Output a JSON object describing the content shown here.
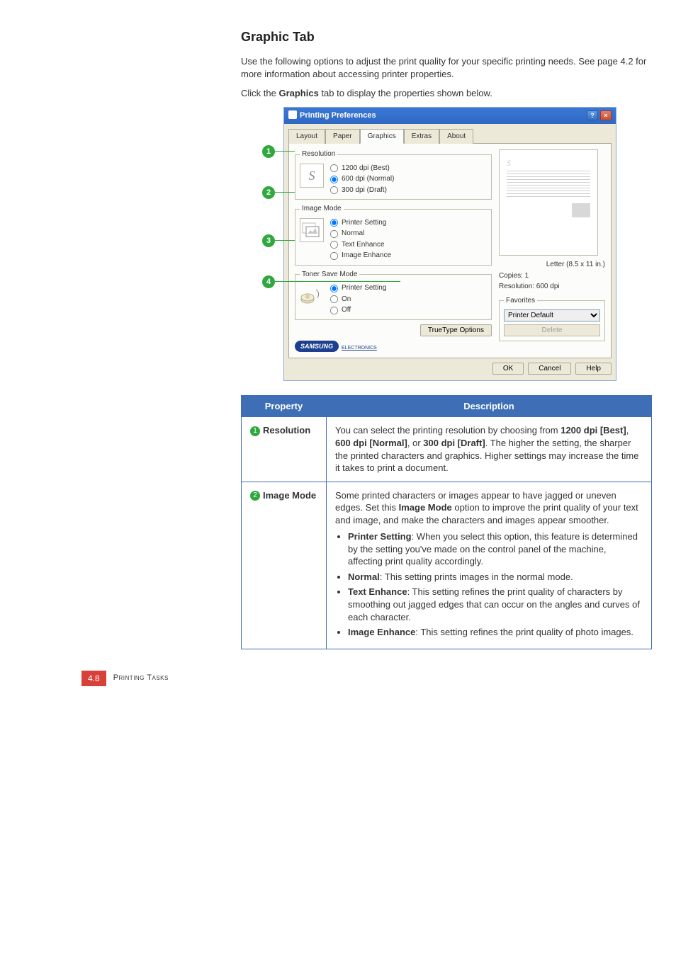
{
  "section": {
    "title": "Graphic Tab",
    "intro": "Use the following options to adjust the print quality for your specific printing needs. See page 4.2 for more information about accessing printer properties.",
    "click_line_prefix": "Click the ",
    "click_line_bold": "Graphics",
    "click_line_suffix": " tab to display the properties shown below."
  },
  "dialog": {
    "title": "Printing Preferences",
    "help_btn": "?",
    "close_btn": "×",
    "tabs": [
      "Layout",
      "Paper",
      "Graphics",
      "Extras",
      "About"
    ],
    "active_tab": "Graphics",
    "resolution": {
      "legend": "Resolution",
      "icon_letter": "S",
      "options": [
        "1200 dpi (Best)",
        "600 dpi (Normal)",
        "300 dpi (Draft)"
      ],
      "selected": "600 dpi (Normal)"
    },
    "image_mode": {
      "legend": "Image Mode",
      "options": [
        "Printer Setting",
        "Normal",
        "Text Enhance",
        "Image Enhance"
      ],
      "selected": "Printer Setting"
    },
    "toner_save": {
      "legend": "Toner Save Mode",
      "options": [
        "Printer Setting",
        "On",
        "Off"
      ],
      "selected": "Printer Setting"
    },
    "truetype_btn": "TrueType Options",
    "brand": "SAMSUNG",
    "brand_sub": "ELECTRONICS",
    "preview": {
      "s": "S",
      "paper_label": "Letter (8.5 x 11 in.)",
      "copies_label": "Copies: 1",
      "resolution_label": "Resolution: 600 dpi"
    },
    "favorites": {
      "legend": "Favorites",
      "selected": "Printer Default",
      "delete": "Delete"
    },
    "buttons": {
      "ok": "OK",
      "cancel": "Cancel",
      "help": "Help"
    }
  },
  "callouts": [
    "1",
    "2",
    "3",
    "4"
  ],
  "table": {
    "headers": {
      "property": "Property",
      "description": "Description"
    },
    "row1": {
      "num": "1",
      "name": "Resolution",
      "desc_pre": "You can select the printing resolution by choosing from ",
      "b1": "1200 dpi [Best]",
      "sep1": ", ",
      "b2": "600 dpi [Normal]",
      "sep2": ", or ",
      "b3": "300 dpi [Draft]",
      "desc_post": ". The higher the setting, the sharper the printed characters and graphics. Higher settings may increase the time it takes to print a document."
    },
    "row2": {
      "num": "2",
      "name": "Image Mode",
      "intro_pre": "Some printed characters or images appear to have jagged or uneven edges. Set this ",
      "intro_bold": "Image Mode",
      "intro_post": " option to improve the print quality of your text and image, and make the characters and images appear smoother.",
      "li1_b": "Printer Setting",
      "li1_t": ": When you select this option, this feature is determined by the setting you've made on the control panel of the machine, affecting print quality accordingly.",
      "li2_b": "Normal",
      "li2_t": ": This setting prints images in the normal mode.",
      "li3_b": "Text Enhance",
      "li3_t": ": This setting refines the print quality of characters by smoothing out jagged edges that can occur on the angles and curves of each character.",
      "li4_b": "Image Enhance",
      "li4_t": ": This setting refines the print quality of photo images."
    }
  },
  "footer": {
    "page": "4.8",
    "section": "Printing Tasks"
  }
}
